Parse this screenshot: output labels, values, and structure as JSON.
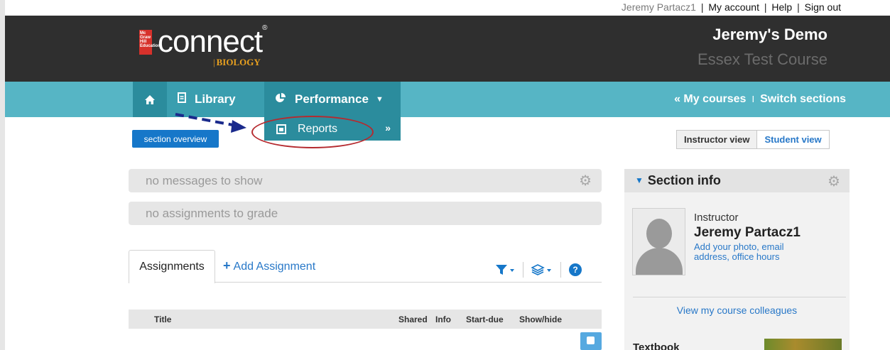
{
  "topbar": {
    "user_name": "Jeremy Partacz1",
    "links": [
      "My account",
      "Help",
      "Sign out"
    ],
    "separator": "|"
  },
  "header": {
    "logo_box_text": "Mc Graw Hill Education",
    "logo_text": "connect",
    "logo_registered": "®",
    "logo_subject": "BIOLOGY",
    "course_title": "Jeremy's Demo",
    "course_subtitle": "Essex Test Course"
  },
  "nav": {
    "library_label": "Library",
    "performance_label": "Performance",
    "my_courses_label": "« My courses",
    "divider": "I",
    "switch_sections_label": "Switch sections"
  },
  "dropdown": {
    "reports_label": "Reports",
    "more_label": "»"
  },
  "section_overview_label": "section overview",
  "view_toggle": {
    "instructor_label": "Instructor view",
    "student_label": "Student view"
  },
  "messages": {
    "no_messages": "no messages to show",
    "no_assignments": "no assignments to grade"
  },
  "assignments": {
    "tab_label": "Assignments",
    "add_label": "Add Assignment",
    "columns": [
      "Title",
      "Shared",
      "Info",
      "Start-due",
      "Show/hide"
    ]
  },
  "section_info": {
    "title": "Section info",
    "role": "Instructor",
    "name": "Jeremy Partacz1",
    "photo_link": "Add your photo, email address, office hours",
    "colleagues_link": "View my course colleagues",
    "textbook_label": "Textbook"
  },
  "colors": {
    "header_bg": "#2f2f2f",
    "nav_bg": "#56b5c5",
    "nav_active": "#2b8c9d",
    "accent_blue": "#1677c9",
    "annotation_red": "#b52a2f",
    "annotation_arrow": "#1a2a8c"
  },
  "icons": {
    "home": "home-icon",
    "library": "document-icon",
    "performance": "pie-chart-icon",
    "reports": "report-icon",
    "gear": "gear-icon",
    "filter": "filter-icon",
    "layers": "layers-icon",
    "help": "help-icon"
  }
}
